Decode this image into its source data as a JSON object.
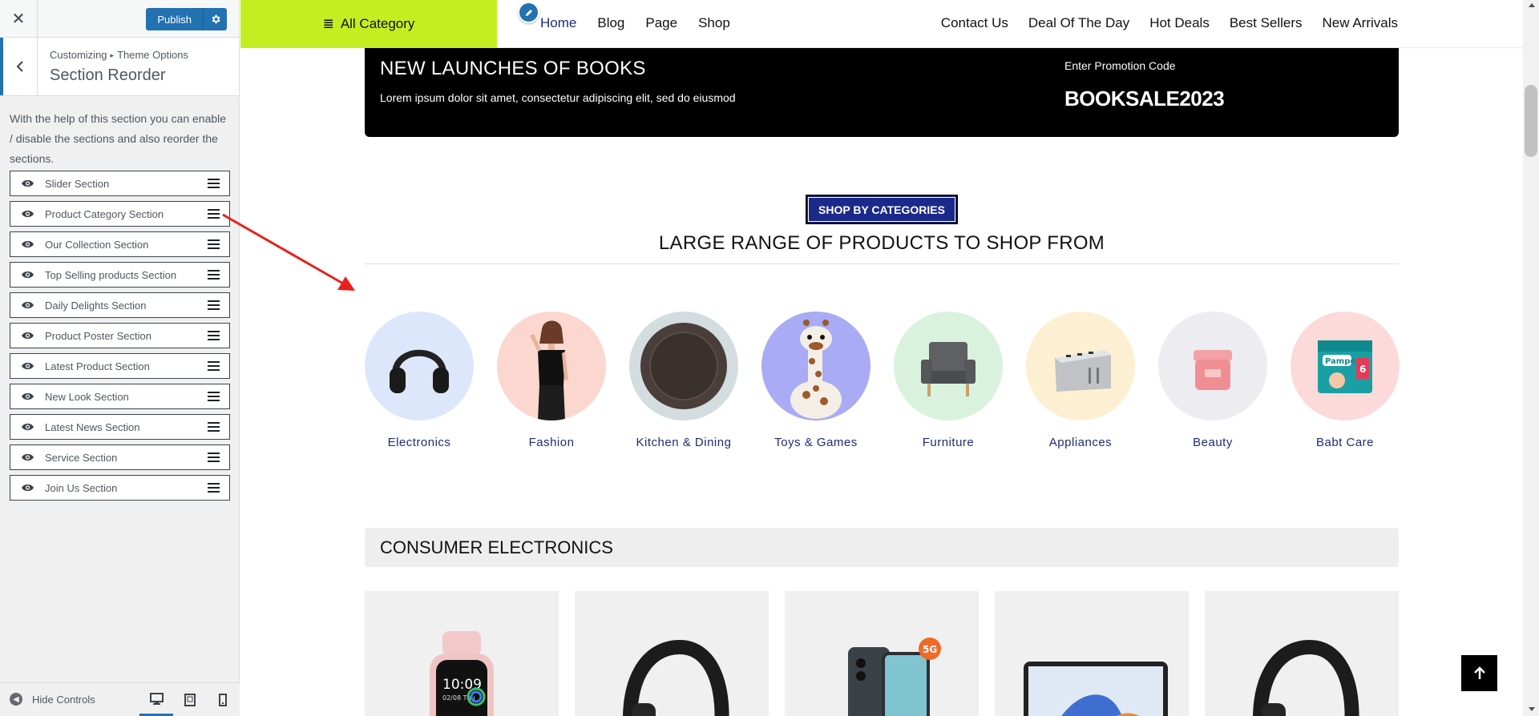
{
  "customizer": {
    "close_icon": "close-icon",
    "publish_label": "Publish",
    "breadcrumb": [
      "Customizing",
      "Theme Options"
    ],
    "section_title": "Section Reorder",
    "description": "With the help of this section you can enable / disable the sections and also reorder the sections.",
    "sections": [
      {
        "label": "Slider Section"
      },
      {
        "label": "Product Category Section"
      },
      {
        "label": "Our Collection Section"
      },
      {
        "label": "Top Selling products Section"
      },
      {
        "label": "Daily Delights Section"
      },
      {
        "label": "Product Poster Section"
      },
      {
        "label": "Latest Product Section"
      },
      {
        "label": "New Look Section"
      },
      {
        "label": "Latest News Section"
      },
      {
        "label": "Service Section"
      },
      {
        "label": "Join Us Section"
      }
    ],
    "hide_controls_label": "Hide Controls",
    "accent_color": "#2271b1"
  },
  "site": {
    "all_category_label": "All Category",
    "nav_left": [
      "Home",
      "Blog",
      "Page",
      "Shop"
    ],
    "nav_right": [
      "Contact Us",
      "Deal Of The Day",
      "Hot Deals",
      "Best Sellers",
      "New Arrivals"
    ],
    "brand_green": "#c5ee22",
    "brand_navy": "#1b2a8a",
    "promo": {
      "title": "NEW LAUNCHES OF BOOKS",
      "text": "Lorem ipsum dolor sit amet, consectetur adipiscing elit, sed do eiusmod",
      "code_label": "Enter Promotion Code",
      "code": "BOOKSALE2023"
    },
    "shop_badge": "SHOP BY CATEGORIES",
    "range_title": "LARGE RANGE OF PRODUCTS TO SHOP FROM",
    "categories": [
      {
        "label": "Electronics",
        "bg": "#dde7fb",
        "icon": "headphones-icon"
      },
      {
        "label": "Fashion",
        "bg": "#fbd7cf",
        "icon": "fashion-model-icon"
      },
      {
        "label": "Kitchen & Dining",
        "bg": "#d3dddf",
        "icon": "plate-icon"
      },
      {
        "label": "Toys & Games",
        "bg": "#a9abf5",
        "icon": "giraffe-toy-icon"
      },
      {
        "label": "Furniture",
        "bg": "#d9f2dd",
        "icon": "armchair-icon"
      },
      {
        "label": "Appliances",
        "bg": "#fdf0d2",
        "icon": "toaster-icon"
      },
      {
        "label": "Beauty",
        "bg": "#ececf1",
        "icon": "cosmetic-jar-icon"
      },
      {
        "label": "Babt Care",
        "bg": "#fcdada",
        "icon": "diaper-pack-icon"
      }
    ],
    "consumer_title": "CONSUMER ELECTRONICS",
    "products": [
      {
        "icon": "smartwatch-icon",
        "watch_time": "10:09",
        "watch_date": "02/08 Thu"
      },
      {
        "icon": "headphones-icon"
      },
      {
        "icon": "smartphone-icon",
        "badge": "5G"
      },
      {
        "icon": "tablet-icon"
      },
      {
        "icon": "headphones-icon"
      }
    ]
  }
}
